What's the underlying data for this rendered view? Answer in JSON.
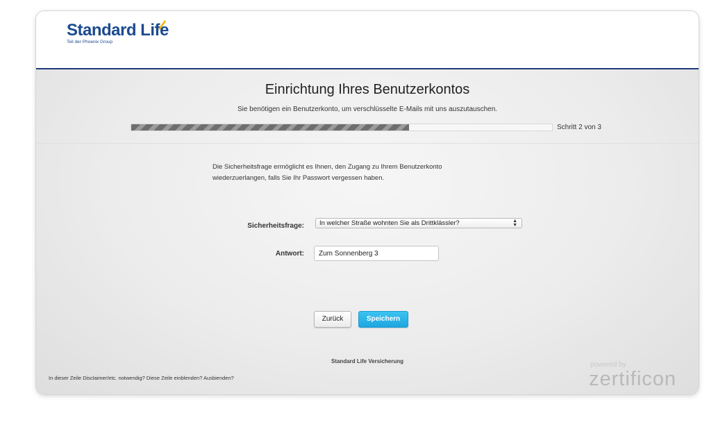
{
  "header": {
    "logo_name": "Standard Life",
    "logo_sub": "Teil der Phoenix Group",
    "brand_color": "#1c4a8f",
    "accent_color": "#f5b800"
  },
  "page": {
    "title": "Einrichtung Ihres Benutzerkontos",
    "subtitle": "Sie benötigen ein Benutzerkonto, um verschlüsselte E-Mails mit uns auszutauschen."
  },
  "progress": {
    "fraction": 0.66,
    "label": "Schritt 2 von 3"
  },
  "form": {
    "info_line1": "Die Sicherheitsfrage ermöglicht es Ihnen, den Zugang zu Ihrem Benutzerkonto",
    "info_line2": "wiederzuerlangen, falls Sie Ihr Passwort vergessen haben.",
    "question_label": "Sicherheitsfrage:",
    "question_value": "In welcher Straße wohnten Sie als Drittklässler?",
    "answer_label": "Antwort:",
    "answer_value": "Zum Sonnenberg 3"
  },
  "buttons": {
    "back_label": "Zurück",
    "save_label": "Speichern",
    "save_color": "#1ea6e0"
  },
  "footer": {
    "company": "Standard Life Versicherung",
    "disclaimer": "In dieser Zeile Disclaimer/etc. notwendig? Diese Zeile einblenden? Ausbienden?",
    "powered_by": "powered by",
    "vendor": "zertificon"
  }
}
